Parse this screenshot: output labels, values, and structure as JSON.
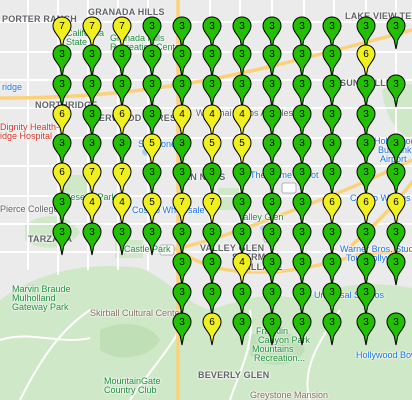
{
  "places": [
    {
      "key": "porter-ranch",
      "text": "PORTER RANCH",
      "tone": ""
    },
    {
      "key": "granada-hills-top",
      "text": "GRANADA HILLS",
      "tone": ""
    },
    {
      "key": "lake-view-terrace",
      "text": "LAKE VIEW TERRACE",
      "tone": ""
    },
    {
      "key": "california-state",
      "text": "California",
      "tone": "green"
    },
    {
      "key": "university-text",
      "text": "State",
      "tone": "green"
    },
    {
      "key": "granada-hills",
      "text": "Granada Hills",
      "tone": "green"
    },
    {
      "key": "recreation-center",
      "text": "Recreation Center",
      "tone": "green"
    },
    {
      "key": "sun-valley",
      "text": "SUN VALLEY",
      "tone": ""
    },
    {
      "key": "northridge",
      "text": "NORTHRIDGE",
      "tone": ""
    },
    {
      "key": "northridge-fashion",
      "text": "ridge",
      "tone": "blue"
    },
    {
      "key": "wat-thai",
      "text": "Wat Thai of Los Angeles",
      "tone": ""
    },
    {
      "key": "dignity-health",
      "text": "Dignity Health-",
      "tone": "red"
    },
    {
      "key": "ridge-hospital",
      "text": "idge Hospital",
      "tone": "red"
    },
    {
      "key": "sherwood-forest",
      "text": "SHERWOOD FOREST",
      "tone": ""
    },
    {
      "key": "hollywood-burbank",
      "text": "Hollywood",
      "tone": "blue"
    },
    {
      "key": "burbank-airport",
      "text": "Burbank",
      "tone": "blue"
    },
    {
      "key": "airport",
      "text": "Airport",
      "tone": "blue"
    },
    {
      "key": "skyzone",
      "text": "Sky Zone",
      "tone": "blue"
    },
    {
      "key": "van-nuys",
      "text": "VAN NUYS",
      "tone": ""
    },
    {
      "key": "home-depot",
      "text": "The Home Depot",
      "tone": "blue"
    },
    {
      "key": "reseda-park",
      "text": "Reseda Park",
      "tone": "green"
    },
    {
      "key": "costco-wholesale",
      "text": "Costco Wholesale",
      "tone": "blue"
    },
    {
      "key": "costco-wholesale-east",
      "text": "Costco Wholes",
      "tone": "blue"
    },
    {
      "key": "pierce-college",
      "text": "Pierce College",
      "tone": ""
    },
    {
      "key": "valley-glen",
      "text": "Valley Glen",
      "tone": "green"
    },
    {
      "key": "tarzana",
      "text": "TARZANA",
      "tone": ""
    },
    {
      "key": "warner-bros",
      "text": "Warner Bros. Stud",
      "tone": "blue"
    },
    {
      "key": "tour-hollywood",
      "text": "Tour Hollywoo",
      "tone": "blue"
    },
    {
      "key": "castle-park",
      "text": "Castle Park",
      "tone": "green"
    },
    {
      "key": "valley-glen-2",
      "text": "VALLEY GLEN",
      "tone": ""
    },
    {
      "key": "sherman-village",
      "text": "SHERMAN",
      "tone": ""
    },
    {
      "key": "village",
      "text": "VILLAGE",
      "tone": ""
    },
    {
      "key": "marvin-braude",
      "text": "Marvin Braude",
      "tone": "green"
    },
    {
      "key": "mulholland",
      "text": "Mulholland",
      "tone": "green"
    },
    {
      "key": "gateway-park",
      "text": "Gateway Park",
      "tone": "green"
    },
    {
      "key": "skirball",
      "text": "Skirball Cultural Center",
      "tone": "brown"
    },
    {
      "key": "universal-studios",
      "text": "Universal Studios",
      "tone": "blue"
    },
    {
      "key": "franklin-canyon",
      "text": "Franklin",
      "tone": "green"
    },
    {
      "key": "canyon-park",
      "text": "Canyon Park",
      "tone": "green"
    },
    {
      "key": "mountains-recreation",
      "text": "Mountains",
      "tone": "green"
    },
    {
      "key": "recreation",
      "text": "Recreation...",
      "tone": "green"
    },
    {
      "key": "hollywood-bowl",
      "text": "Hollywood Bowl",
      "tone": "blue"
    },
    {
      "key": "mountaingate",
      "text": "MountainGate",
      "tone": "green"
    },
    {
      "key": "country-club",
      "text": "Country Club",
      "tone": "green"
    },
    {
      "key": "beverly-glen",
      "text": "BEVERLY GLEN",
      "tone": ""
    },
    {
      "key": "greystone",
      "text": "Greystone Mansion",
      "tone": "brown"
    }
  ],
  "markers": [
    {
      "count": "7",
      "color": "yellow"
    },
    {
      "count": "7",
      "color": "yellow"
    },
    {
      "count": "7",
      "color": "yellow"
    },
    {
      "count": "3",
      "color": "green"
    },
    {
      "count": "3",
      "color": "green"
    },
    {
      "count": "3",
      "color": "green"
    },
    {
      "count": "3",
      "color": "green"
    },
    {
      "count": "3",
      "color": "green"
    },
    {
      "count": "3",
      "color": "green"
    },
    {
      "count": "3",
      "color": "green"
    },
    {
      "count": "3",
      "color": "green"
    },
    {
      "count": "3",
      "color": "green"
    },
    {
      "count": "3",
      "color": "green"
    },
    {
      "count": "3",
      "color": "green"
    },
    {
      "count": "3",
      "color": "green"
    },
    {
      "count": "3",
      "color": "green"
    },
    {
      "count": "3",
      "color": "green"
    },
    {
      "count": "3",
      "color": "green"
    },
    {
      "count": "3",
      "color": "green"
    },
    {
      "count": "3",
      "color": "green"
    },
    {
      "count": "3",
      "color": "green"
    },
    {
      "count": "3",
      "color": "green"
    },
    {
      "count": "6",
      "color": "yellow"
    },
    {
      "count": "3",
      "color": "green"
    },
    {
      "count": "3",
      "color": "green"
    },
    {
      "count": "3",
      "color": "green"
    },
    {
      "count": "3",
      "color": "green"
    },
    {
      "count": "3",
      "color": "green"
    },
    {
      "count": "3",
      "color": "green"
    },
    {
      "count": "3",
      "color": "green"
    },
    {
      "count": "3",
      "color": "green"
    },
    {
      "count": "3",
      "color": "green"
    },
    {
      "count": "3",
      "color": "green"
    },
    {
      "count": "3",
      "color": "green"
    },
    {
      "count": "3",
      "color": "green"
    },
    {
      "count": "6",
      "color": "yellow"
    },
    {
      "count": "3",
      "color": "green"
    },
    {
      "count": "6",
      "color": "yellow"
    },
    {
      "count": "3",
      "color": "green"
    },
    {
      "count": "4",
      "color": "yellow"
    },
    {
      "count": "4",
      "color": "yellow"
    },
    {
      "count": "4",
      "color": "yellow"
    },
    {
      "count": "3",
      "color": "green"
    },
    {
      "count": "3",
      "color": "green"
    },
    {
      "count": "3",
      "color": "green"
    },
    {
      "count": "3",
      "color": "green"
    },
    {
      "count": "3",
      "color": "green"
    },
    {
      "count": "3",
      "color": "green"
    },
    {
      "count": "3",
      "color": "green"
    },
    {
      "count": "5",
      "color": "yellow"
    },
    {
      "count": "3",
      "color": "green"
    },
    {
      "count": "5",
      "color": "yellow"
    },
    {
      "count": "5",
      "color": "yellow"
    },
    {
      "count": "3",
      "color": "green"
    },
    {
      "count": "3",
      "color": "green"
    },
    {
      "count": "3",
      "color": "green"
    },
    {
      "count": "3",
      "color": "green"
    },
    {
      "count": "3",
      "color": "green"
    },
    {
      "count": "6",
      "color": "yellow"
    },
    {
      "count": "7",
      "color": "yellow"
    },
    {
      "count": "7",
      "color": "yellow"
    },
    {
      "count": "3",
      "color": "green"
    },
    {
      "count": "3",
      "color": "green"
    },
    {
      "count": "3",
      "color": "green"
    },
    {
      "count": "3",
      "color": "green"
    },
    {
      "count": "3",
      "color": "green"
    },
    {
      "count": "3",
      "color": "green"
    },
    {
      "count": "3",
      "color": "green"
    },
    {
      "count": "3",
      "color": "green"
    },
    {
      "count": "3",
      "color": "green"
    },
    {
      "count": "3",
      "color": "green"
    },
    {
      "count": "4",
      "color": "yellow"
    },
    {
      "count": "4",
      "color": "yellow"
    },
    {
      "count": "5",
      "color": "yellow"
    },
    {
      "count": "7",
      "color": "yellow"
    },
    {
      "count": "7",
      "color": "yellow"
    },
    {
      "count": "3",
      "color": "green"
    },
    {
      "count": "3",
      "color": "green"
    },
    {
      "count": "3",
      "color": "green"
    },
    {
      "count": "6",
      "color": "yellow"
    },
    {
      "count": "6",
      "color": "yellow"
    },
    {
      "count": "6",
      "color": "yellow"
    },
    {
      "count": "3",
      "color": "green"
    },
    {
      "count": "3",
      "color": "green"
    },
    {
      "count": "3",
      "color": "green"
    },
    {
      "count": "3",
      "color": "green"
    },
    {
      "count": "3",
      "color": "green"
    },
    {
      "count": "3",
      "color": "green"
    },
    {
      "count": "3",
      "color": "green"
    },
    {
      "count": "3",
      "color": "green"
    },
    {
      "count": "3",
      "color": "green"
    },
    {
      "count": "3",
      "color": "green"
    },
    {
      "count": "3",
      "color": "green"
    },
    {
      "count": "3",
      "color": "green"
    },
    {
      "count": "3",
      "color": "green"
    },
    {
      "count": "3",
      "color": "green"
    },
    {
      "count": "4",
      "color": "yellow"
    },
    {
      "count": "3",
      "color": "green"
    },
    {
      "count": "3",
      "color": "green"
    },
    {
      "count": "3",
      "color": "green"
    },
    {
      "count": "3",
      "color": "green"
    },
    {
      "count": "3",
      "color": "green"
    },
    {
      "count": "3",
      "color": "green"
    },
    {
      "count": "3",
      "color": "green"
    },
    {
      "count": "3",
      "color": "green"
    },
    {
      "count": "3",
      "color": "green"
    },
    {
      "count": "3",
      "color": "green"
    },
    {
      "count": "3",
      "color": "green"
    },
    {
      "count": "3",
      "color": "green"
    },
    {
      "count": "3",
      "color": "green"
    },
    {
      "count": "6",
      "color": "yellow"
    },
    {
      "count": "3",
      "color": "green"
    },
    {
      "count": "3",
      "color": "green"
    },
    {
      "count": "3",
      "color": "green"
    },
    {
      "count": "3",
      "color": "green"
    },
    {
      "count": "3",
      "color": "green"
    },
    {
      "count": "3",
      "color": "green"
    }
  ],
  "colors": {
    "marker_green": "#22c000",
    "marker_yellow": "#f0f020",
    "park": "#c9e7c3",
    "road": "#ffffff",
    "highway": "#fde293",
    "water": "#9ecbf0"
  }
}
